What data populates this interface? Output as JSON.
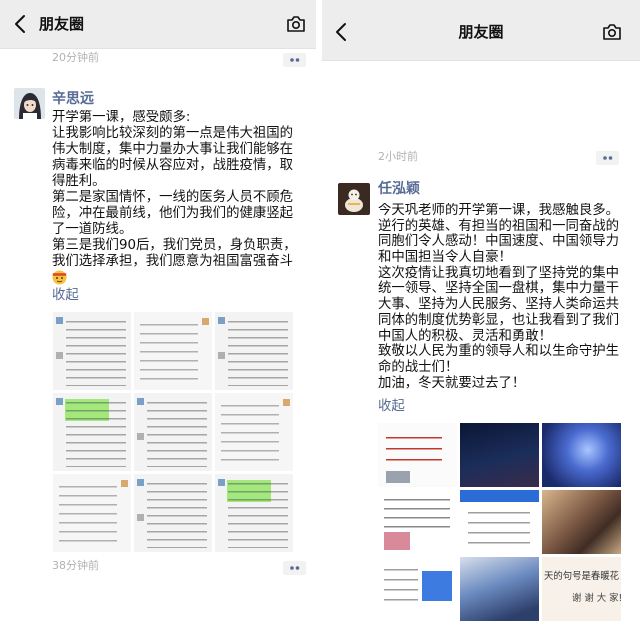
{
  "colors": {
    "name_link": "#576b95",
    "timestamp": "#b2b2b2",
    "header_bg": "#ededed",
    "text": "#111111"
  },
  "left": {
    "header": {
      "title": "朋友圈",
      "back_icon": "chevron-left-icon",
      "camera_icon": "camera-icon"
    },
    "previous_post": {
      "timestamp": "20分钟前",
      "more_icon": "two-dots-icon"
    },
    "post": {
      "author": "辛思远",
      "avatar_icon": "avatar-illustration-girl",
      "lines": [
        "开学第一课，感受颇多:",
        "让我影响比较深刻的第一点是伟大祖国的",
        "伟大制度，集中力量办大事让我们能够在",
        "病毒来临的时候从容应对，战胜疫情，取",
        "得胜利。",
        "第二是家国情怀，一线的医务人员不顾危",
        "险，冲在最前线，他们为我们的健康竖起",
        "了一道防线。",
        "第三是我们90后，我们党员，身负职责，",
        "我们选择承担，我们愿意为祖国富强奋斗"
      ],
      "emoji_icon": "fendou-emoji-icon",
      "collapse_label": "收起",
      "timestamp": "38分钟前",
      "more_icon": "two-dots-icon"
    }
  },
  "right": {
    "header": {
      "title": "朋友圈",
      "back_icon": "chevron-left-icon",
      "camera_icon": "camera-icon"
    },
    "previous_post": {
      "timestamp": "2小时前",
      "more_icon": "two-dots-icon"
    },
    "post": {
      "author": "任泓颖",
      "avatar_icon": "avatar-photo",
      "lines": [
        "今天巩老师的开学第一课，我感触良多。",
        "逆行的英雄、有担当的祖国和一同奋战的",
        "同胞们令人感动！中国速度、中国领导力",
        "和中国担当令人自豪！",
        "这次疫情让我真切地看到了坚持党的集中",
        "统一领导、坚持全国一盘棋，集中力量干",
        "大事、坚持为人民服务、坚持人类命运共",
        "同体的制度优势彰显，也让我看到了我们",
        "中国人的积极、灵活和勇敢！",
        "致敬以人民为重的领导人和以生命守护生",
        "命的战士们！",
        "加油，冬天就要过去了！"
      ],
      "collapse_label": "收起",
      "image_captions": [
        "天的句号是春暖花",
        "谢 谢 大 家!"
      ]
    }
  }
}
